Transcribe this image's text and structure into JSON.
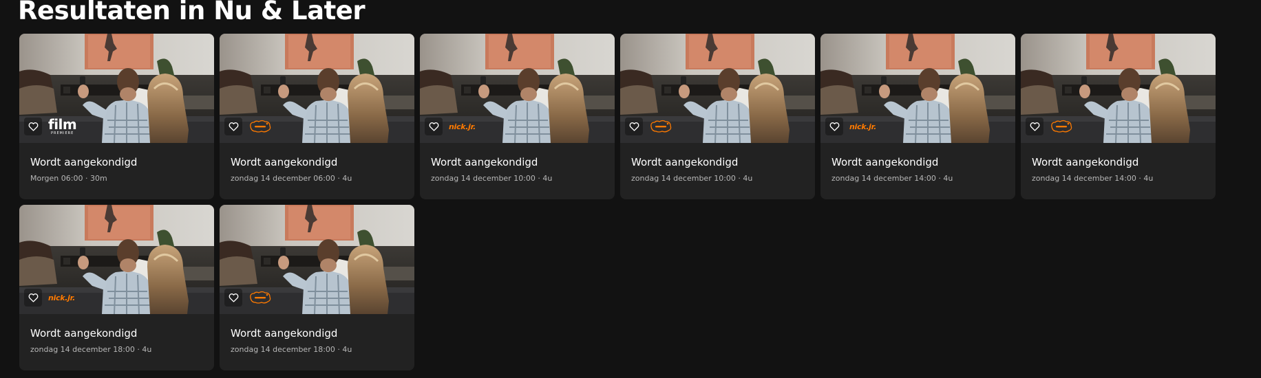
{
  "section": {
    "title": "Resultaten in Nu & Later"
  },
  "icons": {
    "favorite": "heart-outline-icon"
  },
  "colors": {
    "background": "#121212",
    "card": "#222222",
    "channel_accent": "#ff7a00"
  },
  "cards": [
    {
      "title": "Wordt aangekondigd",
      "meta": "Morgen 06:00 · 30m",
      "channel": "film1-premiere",
      "logo_word": "film",
      "logo_sub": "PREMIERE"
    },
    {
      "title": "Wordt aangekondigd",
      "meta": "zondag 14 december 06:00 · 4u",
      "channel": "nickjr"
    },
    {
      "title": "Wordt aangekondigd",
      "meta": "zondag 14 december 10:00 · 4u",
      "channel": "nick",
      "logo_word": "nick.jr."
    },
    {
      "title": "Wordt aangekondigd",
      "meta": "zondag 14 december 10:00 · 4u",
      "channel": "nickjr"
    },
    {
      "title": "Wordt aangekondigd",
      "meta": "zondag 14 december 14:00 · 4u",
      "channel": "nick",
      "logo_word": "nick.jr."
    },
    {
      "title": "Wordt aangekondigd",
      "meta": "zondag 14 december 14:00 · 4u",
      "channel": "nickjr"
    },
    {
      "title": "Wordt aangekondigd",
      "meta": "zondag 14 december 18:00 · 4u",
      "channel": "nick",
      "logo_word": "nick.jr."
    },
    {
      "title": "Wordt aangekondigd",
      "meta": "zondag 14 december 18:00 · 4u",
      "channel": "nickjr"
    }
  ]
}
